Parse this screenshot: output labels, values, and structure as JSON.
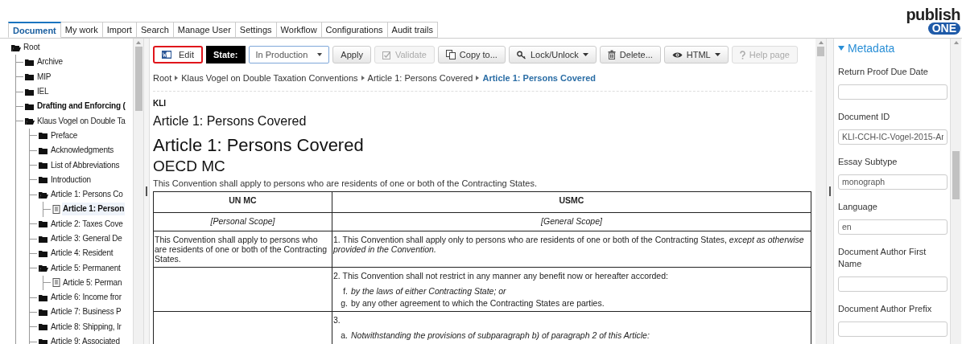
{
  "logo": {
    "word": "publish",
    "badge": "ONE"
  },
  "tabs": [
    {
      "label": "Document",
      "selected": true
    },
    {
      "label": "My work",
      "selected": false
    },
    {
      "label": "Import",
      "selected": false
    },
    {
      "label": "Search",
      "selected": false
    },
    {
      "label": "Manage User",
      "selected": false
    },
    {
      "label": "Settings",
      "selected": false
    },
    {
      "label": "Workflow",
      "selected": false
    },
    {
      "label": "Configurations",
      "selected": false
    },
    {
      "label": "Audit trails",
      "selected": false
    }
  ],
  "tree": [
    {
      "label": "Root",
      "kind": "folder",
      "expanded": true,
      "bold": false,
      "selected": false,
      "children": [
        {
          "label": "Archive",
          "kind": "folder",
          "expanded": false,
          "bold": false,
          "selected": false
        },
        {
          "label": "MIP",
          "kind": "folder",
          "expanded": false,
          "bold": false,
          "selected": false
        },
        {
          "label": "IEL",
          "kind": "folder",
          "expanded": false,
          "bold": false,
          "selected": false
        },
        {
          "label": "Drafting and Enforcing (",
          "kind": "folder",
          "expanded": false,
          "bold": true,
          "selected": false
        },
        {
          "label": "Klaus Vogel on Double Ta",
          "kind": "folder",
          "expanded": true,
          "bold": false,
          "selected": false,
          "children": [
            {
              "label": "Preface",
              "kind": "folder",
              "expanded": false,
              "bold": false,
              "selected": false
            },
            {
              "label": "Acknowledgments",
              "kind": "folder",
              "expanded": false,
              "bold": false,
              "selected": false
            },
            {
              "label": "List of Abbreviations",
              "kind": "folder",
              "expanded": false,
              "bold": false,
              "selected": false
            },
            {
              "label": "Introduction",
              "kind": "folder",
              "expanded": false,
              "bold": false,
              "selected": false
            },
            {
              "label": "Article 1: Persons Co",
              "kind": "folder",
              "expanded": true,
              "bold": false,
              "selected": false,
              "children": [
                {
                  "label": "Article 1: Person",
                  "kind": "document",
                  "bold": true,
                  "selected": true
                }
              ]
            },
            {
              "label": "Article 2: Taxes Cove",
              "kind": "folder",
              "expanded": false,
              "bold": false,
              "selected": false
            },
            {
              "label": "Article 3: General De",
              "kind": "folder",
              "expanded": false,
              "bold": false,
              "selected": false
            },
            {
              "label": "Article 4: Resident",
              "kind": "folder",
              "expanded": false,
              "bold": false,
              "selected": false
            },
            {
              "label": "Article 5: Permanent",
              "kind": "folder",
              "expanded": true,
              "bold": false,
              "selected": false,
              "children": [
                {
                  "label": "Article 5: Perman",
                  "kind": "document",
                  "bold": false,
                  "selected": false
                }
              ]
            },
            {
              "label": "Article 6: Income fror",
              "kind": "folder",
              "expanded": false,
              "bold": false,
              "selected": false
            },
            {
              "label": "Article 7: Business P",
              "kind": "folder",
              "expanded": false,
              "bold": false,
              "selected": false
            },
            {
              "label": "Article 8: Shipping, Ir",
              "kind": "folder",
              "expanded": false,
              "bold": false,
              "selected": false
            },
            {
              "label": "Article 9: Associated",
              "kind": "folder",
              "expanded": false,
              "bold": false,
              "selected": false
            }
          ]
        }
      ]
    }
  ],
  "toolbar": [
    {
      "kind": "button",
      "label": "Edit",
      "focused": true,
      "disabled": false,
      "caret": false
    },
    {
      "kind": "state-label",
      "label": "State:"
    },
    {
      "kind": "select",
      "label": "In Production"
    },
    {
      "kind": "button",
      "label": "Apply",
      "focused": false,
      "disabled": false,
      "caret": false
    },
    {
      "kind": "button",
      "label": "Validate",
      "focused": false,
      "disabled": true,
      "caret": false
    },
    {
      "kind": "button",
      "label": "Copy to...",
      "focused": false,
      "disabled": false,
      "caret": false
    },
    {
      "kind": "button",
      "label": "Lock/Unlock",
      "focused": false,
      "disabled": false,
      "caret": true
    },
    {
      "kind": "button",
      "label": "Delete...",
      "focused": false,
      "disabled": false,
      "caret": false
    },
    {
      "kind": "button",
      "label": "HTML",
      "focused": false,
      "disabled": false,
      "caret": true
    },
    {
      "kind": "button",
      "label": "Help page",
      "focused": false,
      "disabled": true,
      "caret": false
    }
  ],
  "breadcrumb": [
    {
      "label": "Root",
      "current": false
    },
    {
      "label": "Klaus Vogel on Double Taxation Conventions",
      "current": false
    },
    {
      "label": "Article 1: Persons Covered",
      "current": false
    },
    {
      "label": "Article 1: Persons Covered",
      "current": true
    }
  ],
  "document": {
    "source": "KLI",
    "subtitle": "Article 1: Persons Covered",
    "title": "Article 1: Persons Covered",
    "section": "OECD MC",
    "intro": "This Convention shall apply to persons who are residents of one or both of the Contracting States.",
    "table": {
      "rows": [
        {
          "kind": "header",
          "cells": [
            [
              {
                "kind": "para",
                "text": "UN MC"
              }
            ],
            [
              {
                "kind": "para",
                "text": "USMC"
              }
            ]
          ]
        },
        {
          "kind": "scope",
          "cells": [
            [
              {
                "kind": "para",
                "text": "[Personal Scope]"
              }
            ],
            [
              {
                "kind": "para",
                "text": "[General Scope]"
              }
            ]
          ]
        },
        {
          "kind": "body",
          "cells": [
            [
              {
                "kind": "para",
                "text": "This Convention shall apply to persons who are residents of one or both of the Contracting States."
              }
            ],
            [
              {
                "kind": "para",
                "text": "1. This Convention shall apply only to persons who are residents of one or both of the Contracting States, *except as otherwise provided in the Convention.*"
              }
            ]
          ]
        },
        {
          "kind": "body",
          "cells": [
            [],
            [
              {
                "kind": "para",
                "text": "2. This Convention shall not restrict in any manner any benefit now or hereafter accorded:"
              },
              {
                "kind": "item",
                "marker": "f.",
                "text": "*by the laws of either Contracting State; or*"
              },
              {
                "kind": "item",
                "marker": "g.",
                "text": "by any other agreement to which the Contracting States are parties."
              }
            ]
          ]
        },
        {
          "kind": "body",
          "cells": [
            [],
            [
              {
                "kind": "para",
                "text": "3."
              },
              {
                "kind": "item",
                "marker": "a.",
                "text": "*Notwithstanding the provisions of subparagraph b) of paragraph 2 of this Article:*"
              }
            ]
          ]
        }
      ]
    }
  },
  "metadata": {
    "title": "Metadata",
    "expanded": true,
    "fields": [
      {
        "label": "Return Proof Due Date"
      },
      {
        "label": "Document ID",
        "value": "KLI-CCH-IC-Vogel-2015-Ar"
      },
      {
        "label": "Essay Subtype",
        "value": "monograph"
      },
      {
        "label": "Language",
        "value": "en"
      },
      {
        "label": "Document Author First Name"
      },
      {
        "label": "Document Author Prefix"
      }
    ]
  }
}
